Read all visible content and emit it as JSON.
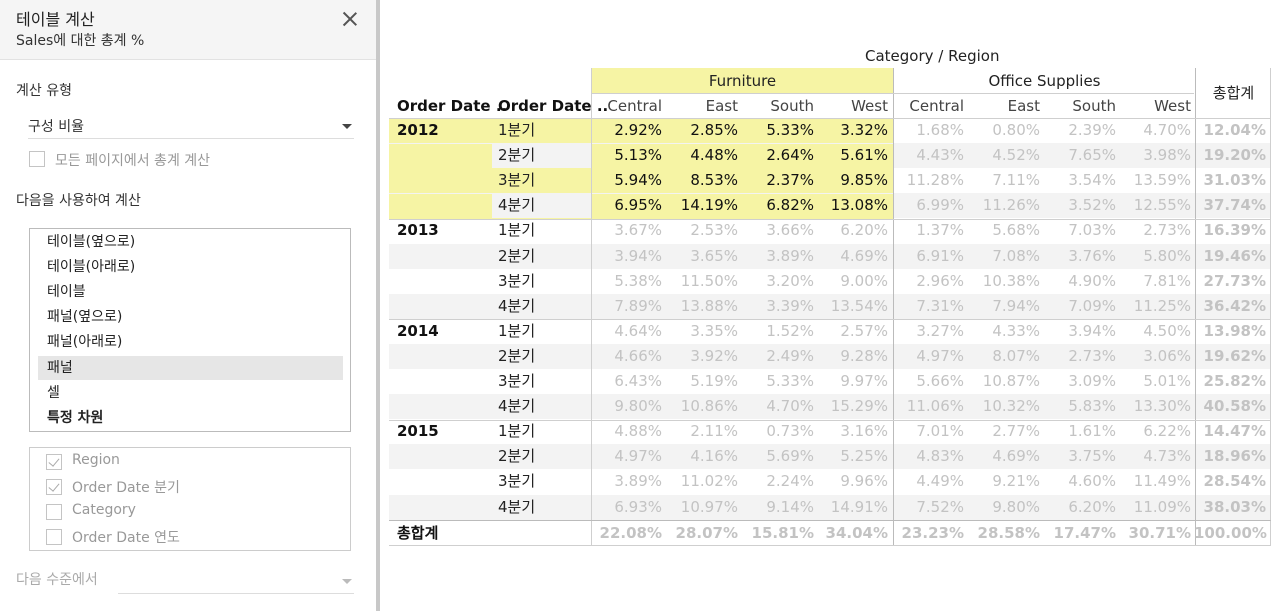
{
  "panel": {
    "title": "테이블 계산",
    "subtitle": "Sales에 대한 총계 %",
    "calc_type_label": "계산 유형",
    "calc_type_value": "구성 비율",
    "all_pages_label": "모든 페이지에서 총계 계산",
    "compute_using_label": "다음을 사용하여 계산",
    "compute_options": [
      "테이블(옆으로)",
      "테이블(아래로)",
      "테이블",
      "패널(옆으로)",
      "패널(아래로)",
      "패널",
      "셀",
      "특정 차원"
    ],
    "selected_option": "패널",
    "dimensions": [
      {
        "label": "Region",
        "checked": true
      },
      {
        "label": "Order Date 분기",
        "checked": true
      },
      {
        "label": "Category",
        "checked": false
      },
      {
        "label": "Order Date 연도",
        "checked": false
      }
    ],
    "level_label": "다음 수준에서",
    "level_value": ""
  },
  "table": {
    "header_title": "Category / Region",
    "row_header_1": "Order Date ..",
    "row_header_2": "Order Date ..",
    "categories": [
      "Furniture",
      "Office Supplies"
    ],
    "regions": [
      "Central",
      "East",
      "South",
      "West",
      "Central",
      "East",
      "South",
      "West"
    ],
    "total_header": "총합계",
    "years": [
      {
        "year": "2012",
        "quarters": [
          {
            "q": "1분기",
            "values": [
              "2.92%",
              "2.85%",
              "5.33%",
              "3.32%",
              "1.68%",
              "0.80%",
              "2.39%",
              "4.70%"
            ],
            "total": "12.04%"
          },
          {
            "q": "2분기",
            "values": [
              "5.13%",
              "4.48%",
              "2.64%",
              "5.61%",
              "4.43%",
              "4.52%",
              "7.65%",
              "3.98%"
            ],
            "total": "19.20%"
          },
          {
            "q": "3분기",
            "values": [
              "5.94%",
              "8.53%",
              "2.37%",
              "9.85%",
              "11.28%",
              "7.11%",
              "3.54%",
              "13.59%"
            ],
            "total": "31.03%"
          },
          {
            "q": "4분기",
            "values": [
              "6.95%",
              "14.19%",
              "6.82%",
              "13.08%",
              "6.99%",
              "11.26%",
              "3.52%",
              "12.55%"
            ],
            "total": "37.74%"
          }
        ]
      },
      {
        "year": "2013",
        "quarters": [
          {
            "q": "1분기",
            "values": [
              "3.67%",
              "2.53%",
              "3.66%",
              "6.20%",
              "1.37%",
              "5.68%",
              "7.03%",
              "2.73%"
            ],
            "total": "16.39%"
          },
          {
            "q": "2분기",
            "values": [
              "3.94%",
              "3.65%",
              "3.89%",
              "4.69%",
              "6.91%",
              "7.08%",
              "3.76%",
              "5.80%"
            ],
            "total": "19.46%"
          },
          {
            "q": "3분기",
            "values": [
              "5.38%",
              "11.50%",
              "3.20%",
              "9.00%",
              "2.96%",
              "10.38%",
              "4.90%",
              "7.81%"
            ],
            "total": "27.73%"
          },
          {
            "q": "4분기",
            "values": [
              "7.89%",
              "13.88%",
              "3.39%",
              "13.54%",
              "7.31%",
              "7.94%",
              "7.09%",
              "11.25%"
            ],
            "total": "36.42%"
          }
        ]
      },
      {
        "year": "2014",
        "quarters": [
          {
            "q": "1분기",
            "values": [
              "4.64%",
              "3.35%",
              "1.52%",
              "2.57%",
              "3.27%",
              "4.33%",
              "3.94%",
              "4.50%"
            ],
            "total": "13.98%"
          },
          {
            "q": "2분기",
            "values": [
              "4.66%",
              "3.92%",
              "2.49%",
              "9.28%",
              "4.97%",
              "8.07%",
              "2.73%",
              "3.06%"
            ],
            "total": "19.62%"
          },
          {
            "q": "3분기",
            "values": [
              "6.43%",
              "5.19%",
              "5.33%",
              "9.97%",
              "5.66%",
              "10.87%",
              "3.09%",
              "5.01%"
            ],
            "total": "25.82%"
          },
          {
            "q": "4분기",
            "values": [
              "9.80%",
              "10.86%",
              "4.70%",
              "15.29%",
              "11.06%",
              "10.32%",
              "5.83%",
              "13.30%"
            ],
            "total": "40.58%"
          }
        ]
      },
      {
        "year": "2015",
        "quarters": [
          {
            "q": "1분기",
            "values": [
              "4.88%",
              "2.11%",
              "0.73%",
              "3.16%",
              "7.01%",
              "2.77%",
              "1.61%",
              "6.22%"
            ],
            "total": "14.47%"
          },
          {
            "q": "2분기",
            "values": [
              "4.97%",
              "4.16%",
              "5.69%",
              "5.25%",
              "4.83%",
              "4.69%",
              "3.75%",
              "4.73%"
            ],
            "total": "18.96%"
          },
          {
            "q": "3분기",
            "values": [
              "3.89%",
              "11.02%",
              "2.24%",
              "9.96%",
              "4.49%",
              "9.21%",
              "4.60%",
              "11.49%"
            ],
            "total": "28.54%"
          },
          {
            "q": "4분기",
            "values": [
              "6.93%",
              "10.97%",
              "9.14%",
              "14.91%",
              "7.52%",
              "9.80%",
              "6.20%",
              "11.09%"
            ],
            "total": "38.03%"
          }
        ]
      }
    ],
    "grand_total_label": "총합계",
    "grand_totals": [
      "22.08%",
      "28.07%",
      "15.81%",
      "34.04%",
      "23.23%",
      "28.58%",
      "17.47%",
      "30.71%"
    ],
    "grand_total_all": "100.00%",
    "highlight_color": "#f6f4a4"
  }
}
